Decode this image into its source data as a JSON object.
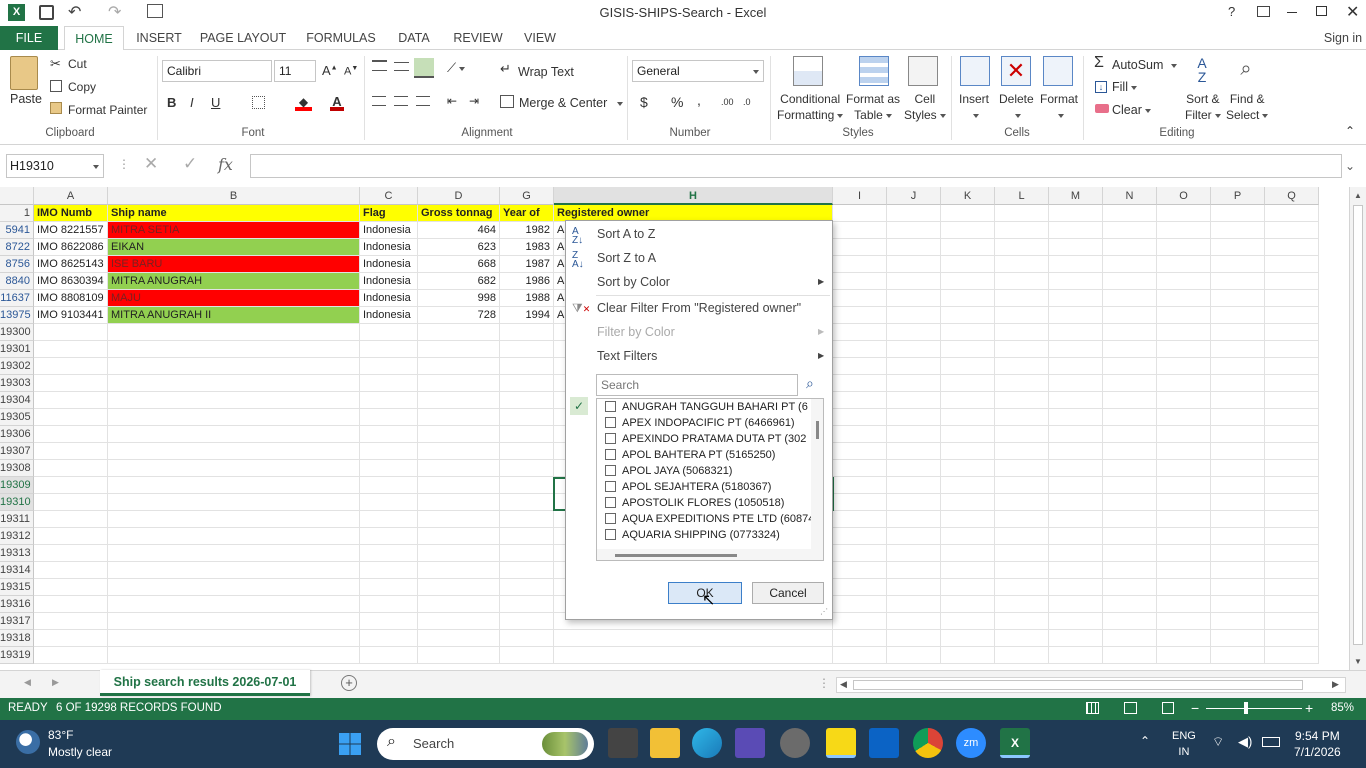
{
  "app": {
    "title": "GISIS-SHIPS-Search - Excel",
    "sign_in": "Sign in"
  },
  "tabs": {
    "file": "FILE",
    "home": "HOME",
    "insert": "INSERT",
    "page_layout": "PAGE LAYOUT",
    "formulas": "FORMULAS",
    "data": "DATA",
    "review": "REVIEW",
    "view": "VIEW"
  },
  "ribbon": {
    "clipboard": {
      "paste": "Paste",
      "cut": "Cut",
      "copy": "Copy",
      "format_painter": "Format Painter",
      "label": "Clipboard"
    },
    "font": {
      "name": "Calibri",
      "size": "11",
      "label": "Font",
      "bold": "B",
      "italic": "I",
      "underline": "U"
    },
    "alignment": {
      "wrap": "Wrap Text",
      "merge": "Merge & Center",
      "label": "Alignment"
    },
    "number": {
      "format": "General",
      "label": "Number",
      "currency": "$",
      "percent": "%",
      "comma": ","
    },
    "styles": {
      "conditional": "Conditional",
      "conditional2": "Formatting",
      "format_as": "Format as",
      "format_as2": "Table",
      "cell": "Cell",
      "cell2": "Styles",
      "label": "Styles"
    },
    "cells": {
      "insert": "Insert",
      "delete": "Delete",
      "format": "Format",
      "label": "Cells"
    },
    "editing": {
      "autosum": "AutoSum",
      "fill": "Fill",
      "clear": "Clear",
      "sort": "Sort &",
      "sort2": "Filter",
      "find": "Find &",
      "find2": "Select",
      "label": "Editing"
    }
  },
  "formula_bar": {
    "name_box": "H19310",
    "fx": "fx",
    "value": ""
  },
  "columns": [
    {
      "id": "A",
      "w": 74
    },
    {
      "id": "B",
      "w": 252
    },
    {
      "id": "C",
      "w": 58
    },
    {
      "id": "D",
      "w": 82
    },
    {
      "id": "G",
      "w": 54
    },
    {
      "id": "H",
      "w": 279
    },
    {
      "id": "I",
      "w": 54
    },
    {
      "id": "J",
      "w": 54
    },
    {
      "id": "K",
      "w": 54
    },
    {
      "id": "L",
      "w": 54
    },
    {
      "id": "M",
      "w": 54
    },
    {
      "id": "N",
      "w": 54
    },
    {
      "id": "O",
      "w": 54
    },
    {
      "id": "P",
      "w": 54
    },
    {
      "id": "Q",
      "w": 54
    }
  ],
  "header_row": {
    "row": "1",
    "cells": [
      "IMO Numb",
      "Ship name",
      "Flag",
      "Gross tonnag",
      "Year of",
      "Registered owner"
    ]
  },
  "data_rows": [
    {
      "row": "5941",
      "imo": "IMO 8221557",
      "name": "MITRA SETIA",
      "color": "red",
      "flag": "Indonesia",
      "gt": "464",
      "year": "1982",
      "owner": "A"
    },
    {
      "row": "8722",
      "imo": "IMO 8622086",
      "name": "EIKAN",
      "color": "green",
      "flag": "Indonesia",
      "gt": "623",
      "year": "1983",
      "owner": "A"
    },
    {
      "row": "8756",
      "imo": "IMO 8625143",
      "name": "ISE BARU",
      "color": "red",
      "flag": "Indonesia",
      "gt": "668",
      "year": "1987",
      "owner": "A"
    },
    {
      "row": "8840",
      "imo": "IMO 8630394",
      "name": "MITRA ANUGRAH",
      "color": "green",
      "flag": "Indonesia",
      "gt": "682",
      "year": "1986",
      "owner": "A"
    },
    {
      "row": "11637",
      "imo": "IMO 8808109",
      "name": "MAJU",
      "color": "red",
      "flag": "Indonesia",
      "gt": "998",
      "year": "1988",
      "owner": "A"
    },
    {
      "row": "13975",
      "imo": "IMO 9103441",
      "name": "MITRA ANUGRAH II",
      "color": "green",
      "flag": "Indonesia",
      "gt": "728",
      "year": "1994",
      "owner": "A"
    }
  ],
  "empty_rows": [
    "19300",
    "19301",
    "19302",
    "19303",
    "19304",
    "19305",
    "19306",
    "19307",
    "19308",
    "19309",
    "19310",
    "19311",
    "19312",
    "19313",
    "19314",
    "19315",
    "19316",
    "19317",
    "19318",
    "19319"
  ],
  "filter_menu": {
    "sort_az": "Sort A to Z",
    "sort_za": "Sort Z to A",
    "sort_color": "Sort by Color",
    "clear_filter": "Clear Filter From \"Registered owner\"",
    "filter_color": "Filter by Color",
    "text_filters": "Text Filters",
    "search_placeholder": "Search",
    "items": [
      "ANUGRAH TANGGUH BAHARI PT (6",
      "APEX INDOPACIFIC PT (6466961)",
      "APEXINDO PRATAMA DUTA PT (302",
      "APOL BAHTERA PT (5165250)",
      "APOL JAYA (5068321)",
      "APOL SEJAHTERA (5180367)",
      "APOSTOLIK FLORES (1050518)",
      "AQUA EXPEDITIONS PTE LTD (60874",
      "AQUARIA SHIPPING (0773324)"
    ],
    "ok": "OK",
    "cancel": "Cancel"
  },
  "sheet_tab": "Ship search results 2026-07-01",
  "status": {
    "ready": "READY",
    "records": "6 OF 19298 RECORDS FOUND",
    "zoom": "85%"
  },
  "taskbar": {
    "temp": "83°F",
    "weather": "Mostly clear",
    "search": "Search",
    "lang": "ENG",
    "lang2": "IN",
    "time": "9:54 PM",
    "date": "7/1/2026"
  }
}
